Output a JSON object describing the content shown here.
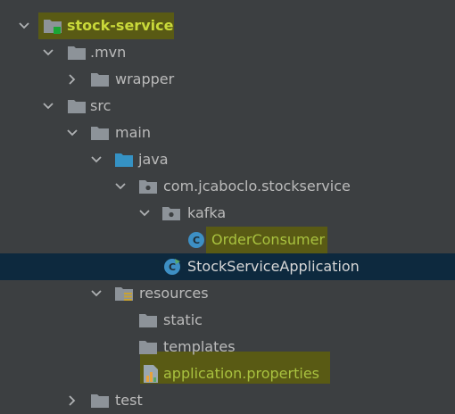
{
  "tree": {
    "root": {
      "label": "stock-service",
      "icon": "module-folder-icon"
    },
    "items": [
      {
        "key": "mvn",
        "label": ".mvn"
      },
      {
        "key": "wrapper",
        "label": "wrapper"
      },
      {
        "key": "src",
        "label": "src"
      },
      {
        "key": "main",
        "label": "main"
      },
      {
        "key": "java",
        "label": "java"
      },
      {
        "key": "package",
        "label": "com.jcaboclo.stockservice"
      },
      {
        "key": "kafka",
        "label": "kafka"
      },
      {
        "key": "order_consumer",
        "label": "OrderConsumer"
      },
      {
        "key": "stock_app",
        "label": "StockServiceApplication"
      },
      {
        "key": "resources",
        "label": "resources"
      },
      {
        "key": "static",
        "label": "static"
      },
      {
        "key": "templates",
        "label": "templates"
      },
      {
        "key": "app_props",
        "label": "application.properties"
      },
      {
        "key": "test",
        "label": "test"
      }
    ]
  },
  "colors": {
    "background": "#3c3f41",
    "selection": "#0d293e",
    "highlight": "#5b5c12",
    "folder": "#8d9399",
    "source_folder": "#3592c4",
    "class_icon": "#3d8fc4"
  }
}
